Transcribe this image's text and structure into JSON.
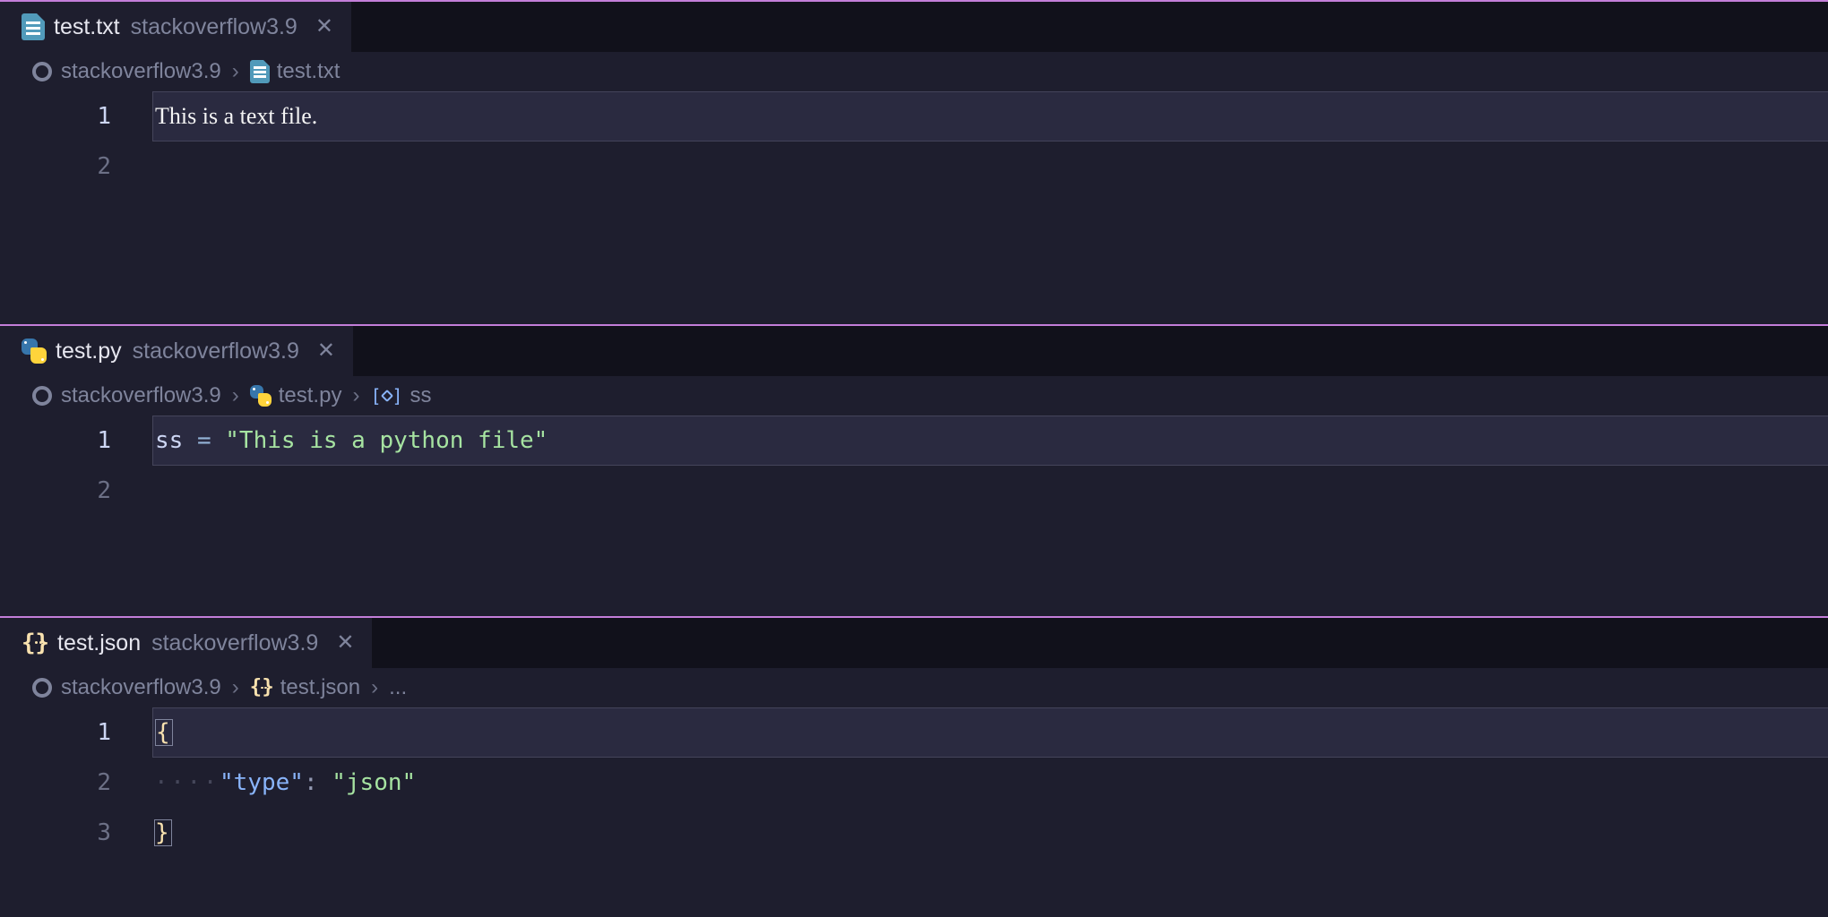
{
  "workspace": "stackoverflow3.9",
  "panes": [
    {
      "filename": "test.txt",
      "icon": "txt",
      "breadcrumb": {
        "root": "stackoverflow3.9",
        "file": "test.txt",
        "symbol": null
      },
      "lines": [
        "1",
        "2"
      ],
      "content": {
        "line1": "This is a text file."
      }
    },
    {
      "filename": "test.py",
      "icon": "py",
      "breadcrumb": {
        "root": "stackoverflow3.9",
        "file": "test.py",
        "symbol": "ss"
      },
      "lines": [
        "1",
        "2"
      ],
      "content": {
        "var": "ss",
        "op": " = ",
        "str": "\"This is a python file\""
      }
    },
    {
      "filename": "test.json",
      "icon": "json",
      "breadcrumb": {
        "root": "stackoverflow3.9",
        "file": "test.json",
        "symbol": "..."
      },
      "lines": [
        "1",
        "2",
        "3"
      ],
      "content": {
        "open": "{",
        "key": "\"type\"",
        "colon": ":",
        "val": "\"json\"",
        "close": "}"
      }
    }
  ]
}
